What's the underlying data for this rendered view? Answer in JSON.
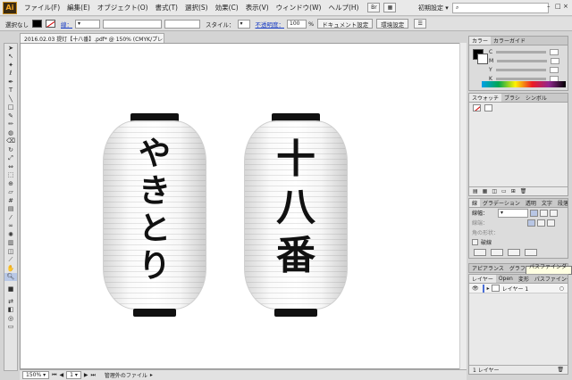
{
  "app": {
    "logo": "Ai",
    "menus": [
      "ファイル(F)",
      "編集(E)",
      "オブジェクト(O)",
      "書式(T)",
      "選択(S)",
      "効果(C)",
      "表示(V)",
      "ウィンドウ(W)",
      "ヘルプ(H)"
    ],
    "workspace_label": "初期設定",
    "workspace_icon": "chevron-down-icon"
  },
  "control_bar": {
    "selection_status": "選択なし",
    "stroke_label": "線：",
    "style_label": "スタイル：",
    "opacity_label": "不透明度：",
    "opacity_value": "100",
    "opacity_unit": "%",
    "doc_settings_button": "ドキュメント設定",
    "prefs_button": "環境設定",
    "fill_color": "#000000",
    "stroke_color": "#ffffff"
  },
  "document": {
    "tab_title": "2016.02.03 提灯【十八番】.pdf* @ 150% (CMYK/プレビュー)",
    "tab_close": "×"
  },
  "artwork": {
    "lantern_left_text": [
      "や",
      "き",
      "と",
      "り"
    ],
    "lantern_right_text": [
      "十",
      "八",
      "番"
    ]
  },
  "status_bar": {
    "zoom": "150%",
    "page": "1",
    "status_text": "管理外のファイル"
  },
  "panels": {
    "color": {
      "tabs": [
        "カラー",
        "カラーガイド"
      ],
      "channels": [
        "C",
        "M",
        "Y",
        "K"
      ]
    },
    "swatch": {
      "tabs": [
        "スウォッチ",
        "ブラシ",
        "シンボル"
      ]
    },
    "stroke": {
      "tabs": [
        "線",
        "グラデーション",
        "透明",
        "文字",
        "段落"
      ],
      "weight_label": "線幅：",
      "cap_label": "線端：",
      "corner_label": "角の形状：",
      "dash_label": "破線"
    },
    "appearance": {
      "tabs": [
        "アピアランス",
        "グラフィックスタイル"
      ]
    },
    "layers": {
      "tabs": [
        "レイヤー",
        "Open",
        "変形",
        "パスファインダー"
      ],
      "layer_name": "レイヤー 1",
      "footer": "1 レイヤー"
    },
    "tooltip": "パスファインダー"
  }
}
